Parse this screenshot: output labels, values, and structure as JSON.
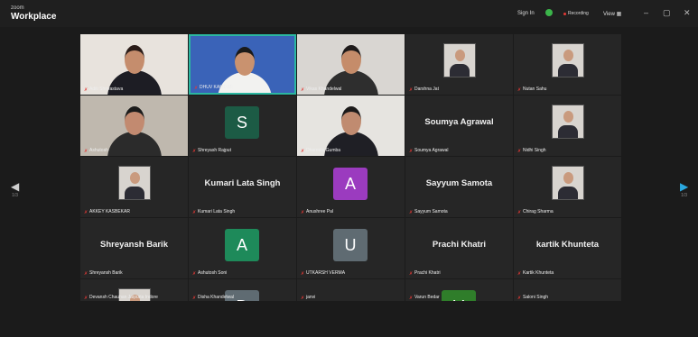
{
  "app": {
    "brand_small": "zoom",
    "brand_big": "Workplace",
    "sign_in": "Sign In",
    "recording": "Recording",
    "view": "View",
    "view_icon": "grid-icon"
  },
  "window_controls": [
    "–",
    "▢",
    "✕"
  ],
  "colors": {
    "green": "#3bb54a",
    "purple": "#9b3bbf",
    "teal_dark": "#1c5b45",
    "gray_avatar": "#5f6b72",
    "mute": "#e53935",
    "active": "#2bb7a0"
  },
  "nav": {
    "left_arrow": "◀",
    "right_arrow": "▶",
    "left_page": "1/3",
    "right_page": "1/3"
  },
  "tiles": [
    {
      "caption": "Aditi Shrivastava",
      "kind": "video"
    },
    {
      "caption": "DHUV KAMDAR",
      "kind": "video",
      "active": true
    },
    {
      "caption": "Vikas Khandelwal",
      "kind": "video"
    },
    {
      "caption": "Darshna Jat",
      "kind": "photo"
    },
    {
      "caption": "Nutan Sahu",
      "kind": "photo"
    },
    {
      "caption": "Ashutosh",
      "kind": "video"
    },
    {
      "caption": "Shreyash Rajput",
      "kind": "avatar",
      "letter": "S",
      "color": "#1c5b45"
    },
    {
      "caption": "Dharmita Gumba",
      "kind": "video"
    },
    {
      "caption": "Soumya Agrawal",
      "kind": "name",
      "name": "Soumya Agrawal"
    },
    {
      "caption": "Nidhi Singh",
      "kind": "photo"
    },
    {
      "caption": "AKKEY KASBEKAR",
      "kind": "photo"
    },
    {
      "caption": "Kumari Lata Singh",
      "kind": "name",
      "name": "Kumari Lata Singh"
    },
    {
      "caption": "Anushree Pal",
      "kind": "avatar",
      "letter": "A",
      "color": "#9b3bbf"
    },
    {
      "caption": "Sayyum Samota",
      "kind": "name",
      "name": "Sayyum Samota"
    },
    {
      "caption": "Chirag Sharma",
      "kind": "photo"
    },
    {
      "caption": "Shreyansh Barik",
      "kind": "name",
      "name": "Shreyansh Barik"
    },
    {
      "caption": "Ashutosh Soni",
      "kind": "avatar",
      "letter": "A",
      "color": "#1e8a5a"
    },
    {
      "caption": "UTKARSH VERMA",
      "kind": "avatar",
      "letter": "U",
      "color": "#5f6b72"
    },
    {
      "caption": "Prachi Khatri",
      "kind": "name",
      "name": "Prachi Khatri"
    },
    {
      "caption": "Kartik Khunteta",
      "kind": "name",
      "name": "kartik Khunteta"
    },
    {
      "caption": "Devansh Chauhan Jaipuria Indore",
      "kind": "photo"
    },
    {
      "caption": "Disha Khandelwal",
      "kind": "avatar",
      "letter": "D",
      "color": "#5f6b72"
    },
    {
      "caption": "janvi",
      "kind": "name",
      "name": "janvi"
    },
    {
      "caption": "Varun Bedar",
      "kind": "avatar",
      "letter": "V",
      "color": "#2f7d2a"
    },
    {
      "caption": "Saloni Singh",
      "kind": "name",
      "name": "Saloni Singh"
    }
  ]
}
